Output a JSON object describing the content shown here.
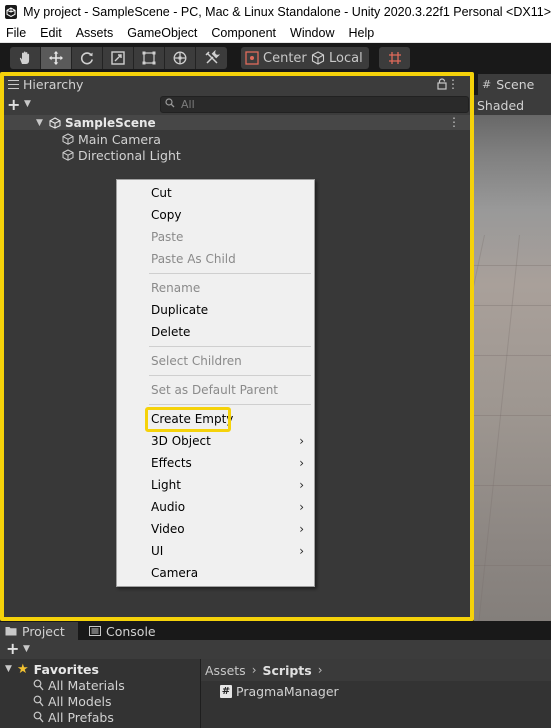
{
  "window": {
    "title": "My project - SampleScene - PC, Mac & Linux Standalone - Unity 2020.3.22f1 Personal <DX11>"
  },
  "menubar": {
    "items": [
      "File",
      "Edit",
      "Assets",
      "GameObject",
      "Component",
      "Window",
      "Help"
    ]
  },
  "toolbar": {
    "tools": [
      "hand-tool-icon",
      "move-tool-icon",
      "rotate-tool-icon",
      "scale-tool-icon",
      "rect-tool-icon",
      "transform-tool-icon",
      "custom-tool-icon"
    ],
    "active_tool": "move-tool-icon",
    "pivot_label": "Center",
    "space_label": "Local"
  },
  "hierarchy": {
    "tab_label": "Hierarchy",
    "search_placeholder": "All",
    "scene_name": "SampleScene",
    "objects": [
      "Main Camera",
      "Directional Light"
    ]
  },
  "scene": {
    "tab_label": "Scene",
    "shading_mode": "Shaded"
  },
  "context_menu": {
    "items": [
      {
        "label": "Cut",
        "enabled": true
      },
      {
        "label": "Copy",
        "enabled": true
      },
      {
        "label": "Paste",
        "enabled": false
      },
      {
        "label": "Paste As Child",
        "enabled": false
      },
      {
        "label": "Rename",
        "enabled": false
      },
      {
        "label": "Duplicate",
        "enabled": true
      },
      {
        "label": "Delete",
        "enabled": true
      },
      {
        "label": "Select Children",
        "enabled": false
      },
      {
        "label": "Set as Default Parent",
        "enabled": false
      },
      {
        "label": "Create Empty",
        "enabled": true,
        "highlighted": true
      },
      {
        "label": "3D Object",
        "enabled": true,
        "submenu": true
      },
      {
        "label": "Effects",
        "enabled": true,
        "submenu": true
      },
      {
        "label": "Light",
        "enabled": true,
        "submenu": true
      },
      {
        "label": "Audio",
        "enabled": true,
        "submenu": true
      },
      {
        "label": "Video",
        "enabled": true,
        "submenu": true
      },
      {
        "label": "UI",
        "enabled": true,
        "submenu": true
      },
      {
        "label": "Camera",
        "enabled": true
      }
    ]
  },
  "bottom": {
    "tabs": [
      "Project",
      "Console"
    ],
    "favorites_label": "Favorites",
    "favorites": [
      "All Materials",
      "All Models",
      "All Prefabs"
    ],
    "breadcrumb": [
      "Assets",
      "Scripts"
    ],
    "assets": [
      "PragmaManager"
    ]
  },
  "colors": {
    "highlight": "#f5d20a",
    "panel_bg": "#383838",
    "menu_bg": "#f0f0f0",
    "favorites_star": "#f2c231"
  }
}
